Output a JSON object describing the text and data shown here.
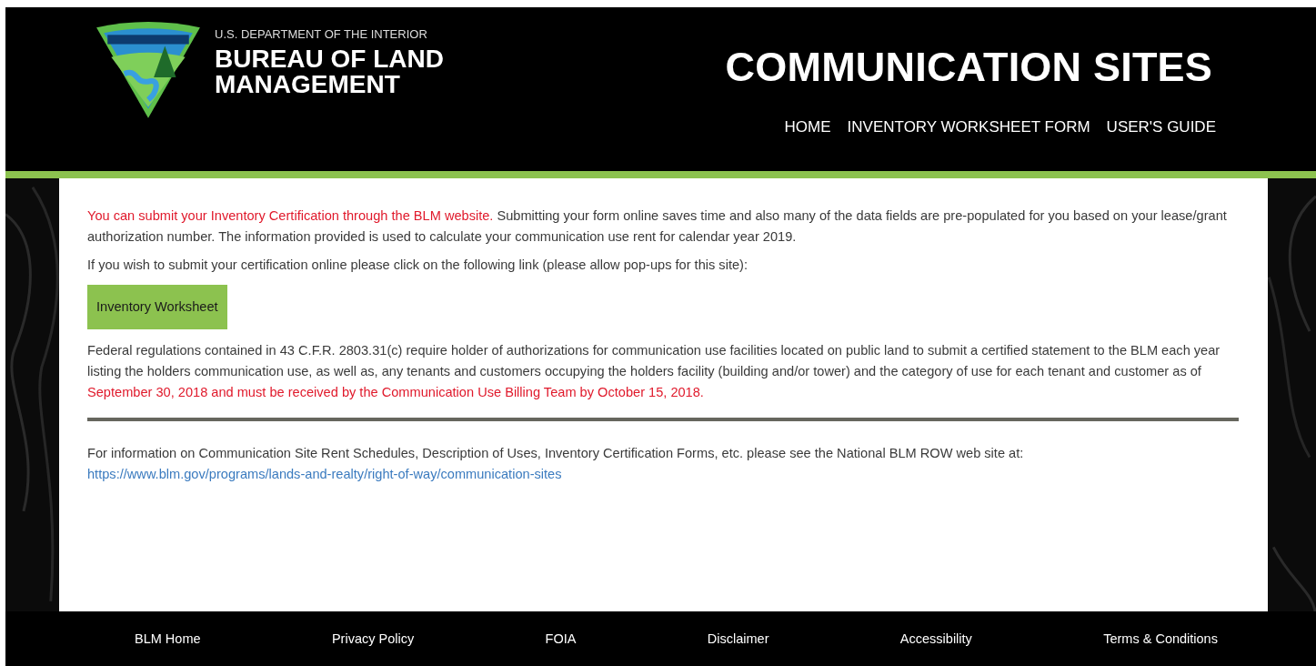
{
  "header": {
    "agency_line": "U.S. DEPARTMENT OF THE INTERIOR",
    "agency_name": [
      "BUREAU OF LAND",
      "MANAGEMENT"
    ],
    "site_title": "COMMUNICATION SITES",
    "nav": [
      {
        "label": "HOME"
      },
      {
        "label": "INVENTORY WORKSHEET FORM"
      },
      {
        "label": "USER'S GUIDE"
      }
    ]
  },
  "content": {
    "intro": [
      {
        "kind": "alert",
        "text": "You can submit your Inventory Certification through the BLM website."
      },
      {
        "kind": "plain",
        "text": " Submitting your form online saves time and also many of the data fields are pre-populated for you based on your lease/grant authorization number. The information provided is used to calculate your communication use rent for calendar year 2019."
      }
    ],
    "instruction": "If you wish to submit your certification online please click on the following link (please allow pop-ups for this site):",
    "button": "Inventory Worksheet",
    "regulation": [
      {
        "kind": "plain",
        "text": "Federal regulations contained in 43 C.F.R. 2803.31(c) require holder of authorizations for communication use facilities located on public land to submit a certified statement to the BLM each year listing the holders communication use, as well as, any tenants and customers occupying the holders facility (building and/or tower) and the category of use for each tenant and customer as of "
      },
      {
        "kind": "alert",
        "text": "September 30, 2018 and must be received by the Communication Use Billing Team by October 15, 2018."
      }
    ],
    "info": "For information on Communication Site Rent Schedules, Description of Uses, Inventory Certification Forms, etc. please see the National BLM ROW web site at:",
    "link": "https://www.blm.gov/programs/lands-and-realty/right-of-way/communication-sites"
  },
  "footer": [
    {
      "label": "BLM Home"
    },
    {
      "label": "Privacy Policy"
    },
    {
      "label": "FOIA"
    },
    {
      "label": "Disclaimer"
    },
    {
      "label": "Accessibility"
    },
    {
      "label": "Terms & Conditions"
    }
  ]
}
